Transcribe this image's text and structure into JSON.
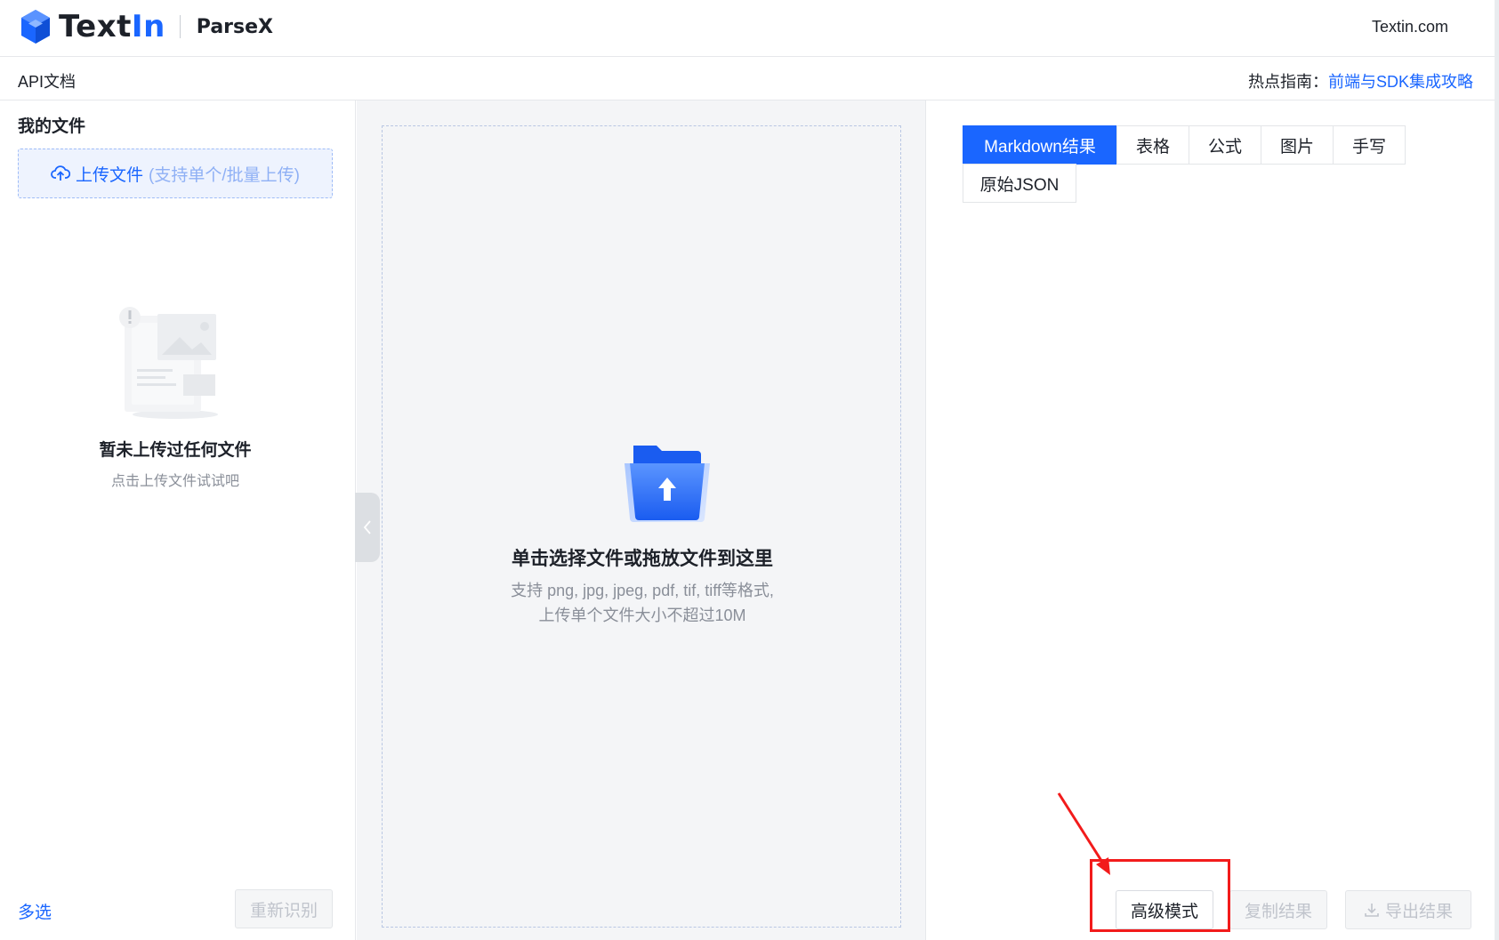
{
  "header": {
    "brand_prefix": "Text",
    "brand_suffix": "In",
    "product": "ParseX",
    "site_link": "Textin.com"
  },
  "subbar": {
    "api_doc": "API文档",
    "hot_guide_label": "热点指南：",
    "hot_guide_link": "前端与SDK集成攻略"
  },
  "left_panel": {
    "title": "我的文件",
    "upload_label": "上传文件",
    "upload_hint": "(支持单个/批量上传)",
    "empty_title": "暂未上传过任何文件",
    "empty_sub": "点击上传文件试试吧",
    "multi_select": "多选",
    "reprocess_button": "重新识别"
  },
  "dropzone": {
    "title": "单击选择文件或拖放文件到这里",
    "sub_line1": "支持 png, jpg, jpeg, pdf, tif, tiff等格式,",
    "sub_line2": "上传单个文件大小不超过10M"
  },
  "result_panel": {
    "tabs": [
      {
        "label": "Markdown结果",
        "active": true
      },
      {
        "label": "表格",
        "active": false
      },
      {
        "label": "公式",
        "active": false
      },
      {
        "label": "图片",
        "active": false
      },
      {
        "label": "手写",
        "active": false
      },
      {
        "label": "原始JSON",
        "active": false
      }
    ],
    "advanced_button": "高级模式",
    "copy_button": "复制结果",
    "export_button": "导出结果"
  },
  "colors": {
    "accent": "#1a66ff",
    "annotation": "#f21b1b"
  },
  "icons": {
    "logo": "textin-cube-logo",
    "upload": "cloud-upload-icon",
    "collapse": "chevron-left-icon",
    "folder": "folder-upload-icon",
    "export": "download-icon"
  }
}
